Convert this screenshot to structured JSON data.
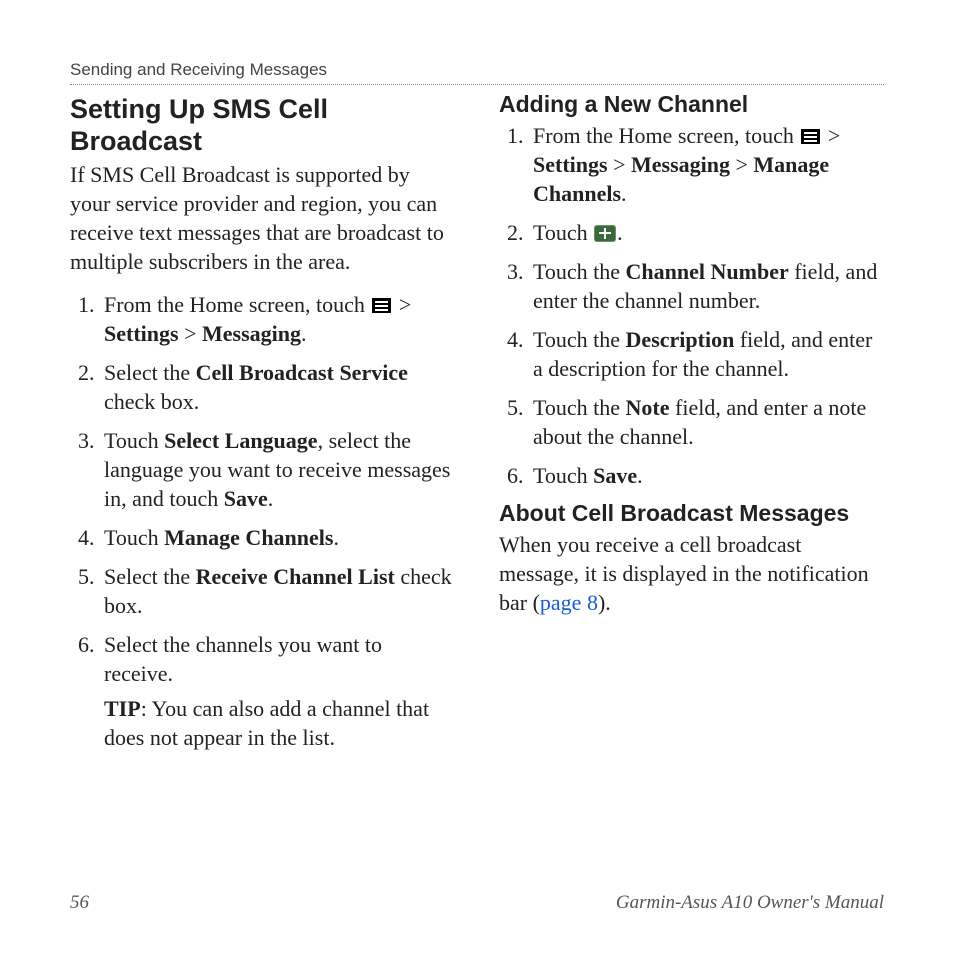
{
  "header": "Sending and Receiving Messages",
  "left": {
    "title": "Setting Up SMS Cell Broadcast",
    "intro": "If SMS Cell Broadcast is supported by your service provider and region, you can receive text messages that are broadcast to multiple subscribers in the area.",
    "step1_a": "From the Home screen, touch ",
    "step1_b": " > ",
    "step1_settings": "Settings",
    "step1_gt": " > ",
    "step1_messaging": "Messaging",
    "step1_dot": ".",
    "step2_a": "Select the ",
    "step2_bold": "Cell Broadcast Service",
    "step2_b": " check box.",
    "step3_a": "Touch ",
    "step3_bold1": "Select Language",
    "step3_b": ", select the language you want to receive messages in, and touch ",
    "step3_bold2": "Save",
    "step3_c": ".",
    "step4_a": "Touch ",
    "step4_bold": "Manage Channels",
    "step4_b": ".",
    "step5_a": "Select the ",
    "step5_bold": "Receive Channel List",
    "step5_b": " check box.",
    "step6": "Select the channels you want to receive.",
    "tip_label": "TIP",
    "tip_body": ": You can also add a channel that does not appear in the list."
  },
  "right": {
    "title1": "Adding a New Channel",
    "r1_a": "From the Home screen, touch ",
    "r1_b": " > ",
    "r1_settings": "Settings",
    "r1_gt1": " > ",
    "r1_messaging": "Messaging",
    "r1_gt2": " > ",
    "r1_manage": "Manage Channels",
    "r1_dot": ".",
    "r2_a": "Touch ",
    "r2_b": ".",
    "r3_a": "Touch the ",
    "r3_bold": "Channel Number",
    "r3_b": " field, and enter the channel number.",
    "r4_a": "Touch the ",
    "r4_bold": "Description",
    "r4_b": " field, and enter a description for the channel.",
    "r5_a": "Touch the ",
    "r5_bold": "Note",
    "r5_b": " field, and enter a note about the channel.",
    "r6_a": "Touch ",
    "r6_bold": "Save",
    "r6_b": ".",
    "title2": "About Cell Broadcast Messages",
    "about_a": "When you receive a cell broadcast message, it is displayed in the notification bar (",
    "about_link": "page 8",
    "about_b": ")."
  },
  "footer": {
    "page": "56",
    "manual": "Garmin-Asus A10 Owner's Manual"
  }
}
